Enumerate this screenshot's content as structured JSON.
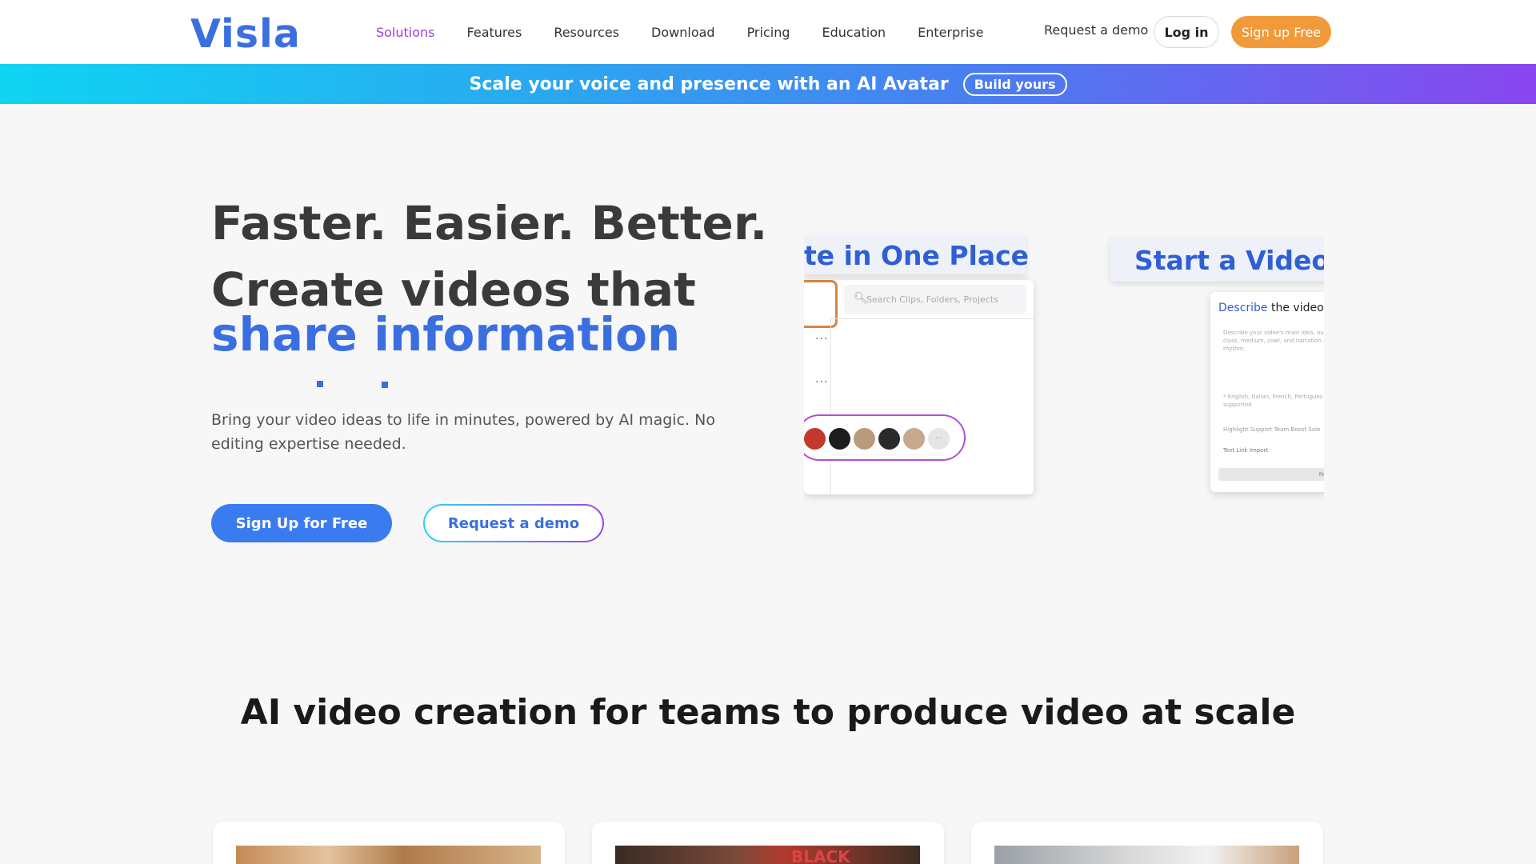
{
  "header": {
    "logo": "Visla",
    "nav": [
      "Solutions",
      "Features",
      "Resources",
      "Download",
      "Pricing",
      "Education",
      "Enterprise"
    ],
    "active_nav": "Solutions",
    "request_demo": "Request a demo",
    "login": "Log in",
    "signup": "Sign up Free"
  },
  "banner": {
    "text": "Scale your voice and presence with an AI Avatar",
    "button": "Build yours"
  },
  "hero": {
    "line1": "Faster. Easier. Better.",
    "line2": "Create videos that",
    "line3": "share information",
    "subtitle": "Bring your video ideas to life in minutes, powered by AI magic. No editing expertise needed.",
    "cta_primary": "Sign Up for Free",
    "cta_secondary": "Request a demo"
  },
  "mockups": {
    "panel1_title": "te in One Place",
    "search_placeholder": "Search Clips, Folders, Projects",
    "more": "···",
    "panel2_title": "Start a Video w",
    "panel2_heading_a": "Describe",
    "panel2_heading_b": " the video y",
    "panel2_desc": "Describe your video's main idea, ou class, medium, cowl, and narration and rhythm.",
    "panel2_langs": "* English, Italian, French, Portugues are supported",
    "panel2_chips": "Highlight Support Team    Boost Sale",
    "panel2_tools": "Text   Link   Import",
    "panel2_next": "Next"
  },
  "section": {
    "heading": "AI video creation for teams to produce video at scale"
  },
  "cards": {
    "card2_sign": "BLACK"
  },
  "colors": {
    "brand": "#3b6fe0",
    "active_nav": "#a23ed6",
    "signup_orange": "#f29a3a",
    "cta_blue": "#3b7bf0"
  }
}
